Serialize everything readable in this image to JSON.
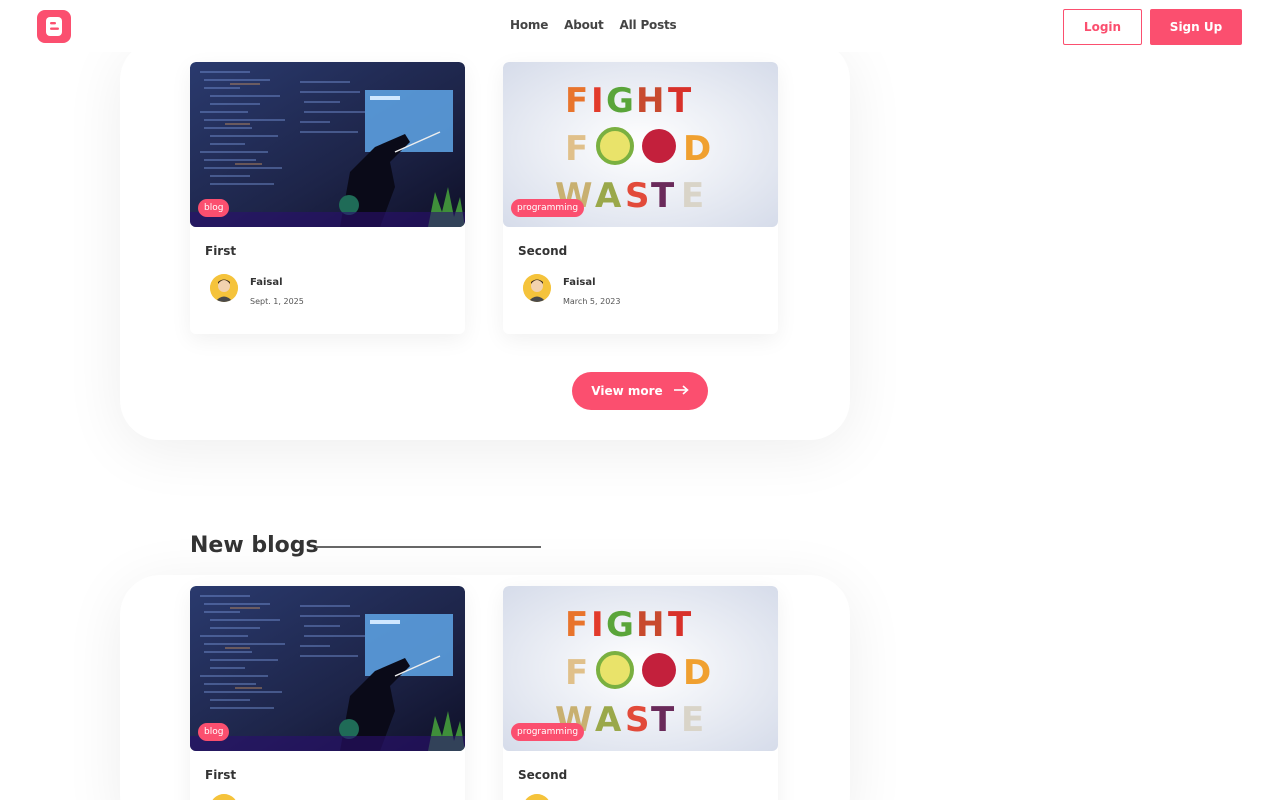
{
  "nav": {
    "links": [
      "Home",
      "About",
      "All Posts"
    ],
    "login_label": "Login",
    "signup_label": "Sign Up"
  },
  "featured": {
    "posts": [
      {
        "title": "First",
        "tag": "blog",
        "author": "Faisal",
        "date": "Sept. 1, 2025",
        "image": "code-screen-image"
      },
      {
        "title": "Second",
        "tag": "programming",
        "author": "Faisal",
        "date": "March 5, 2023",
        "image": "fight-food-waste-image"
      }
    ],
    "view_more_label": "View more"
  },
  "new_blogs": {
    "heading": "New blogs",
    "posts": [
      {
        "title": "First",
        "tag": "blog"
      },
      {
        "title": "Second",
        "tag": "programming"
      }
    ]
  },
  "colors": {
    "accent": "#fb4f6f",
    "text": "#333333"
  }
}
